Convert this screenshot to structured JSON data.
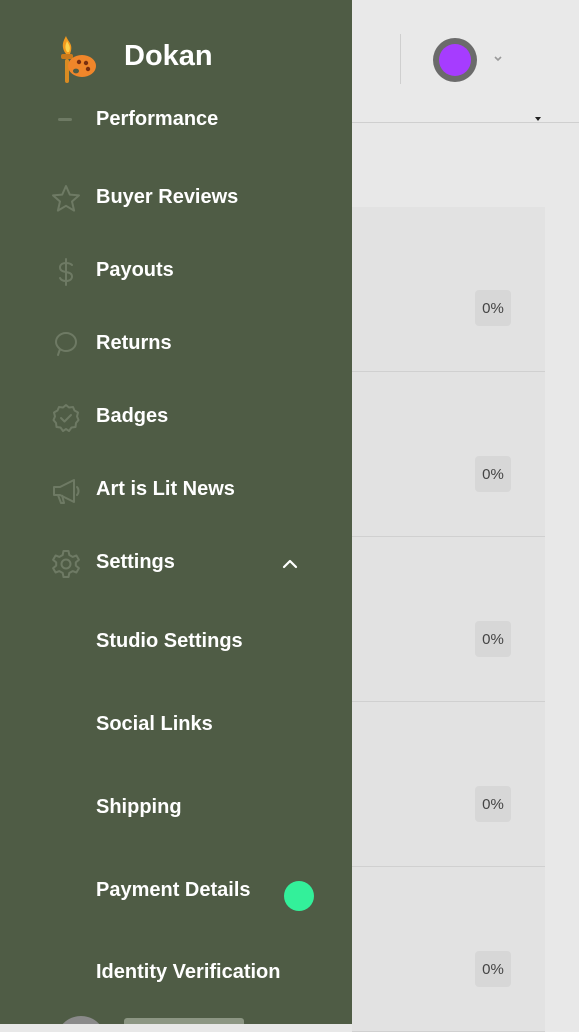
{
  "brand": {
    "name": "Dokan",
    "logo_icon": "torch-palette-logo"
  },
  "menu": {
    "partial_item": {
      "label": "Performance",
      "icon": "chart-icon"
    },
    "items": [
      {
        "label": "Buyer Reviews",
        "icon": "star-icon"
      },
      {
        "label": "Payouts",
        "icon": "dollar-icon"
      },
      {
        "label": "Returns",
        "icon": "return-icon"
      },
      {
        "label": "Badges",
        "icon": "badge-icon"
      },
      {
        "label": "Art is Lit News",
        "icon": "megaphone-icon"
      },
      {
        "label": "Settings",
        "icon": "gear-icon",
        "expanded": true
      }
    ],
    "settings_sub": [
      {
        "label": "Studio Settings"
      },
      {
        "label": "Social Links"
      },
      {
        "label": "Shipping"
      },
      {
        "label": "Payment Details",
        "has_notification": true
      },
      {
        "label": "Identity Verification"
      }
    ]
  },
  "background_cards": [
    {
      "percent": "0%"
    },
    {
      "percent": "0%"
    },
    {
      "percent": "0%"
    },
    {
      "percent": "0%"
    },
    {
      "percent": "0%"
    }
  ],
  "colors": {
    "drawer": "#4f5c45",
    "notification_dot": "#33f09a",
    "avatar_accent": "#a63cff"
  }
}
